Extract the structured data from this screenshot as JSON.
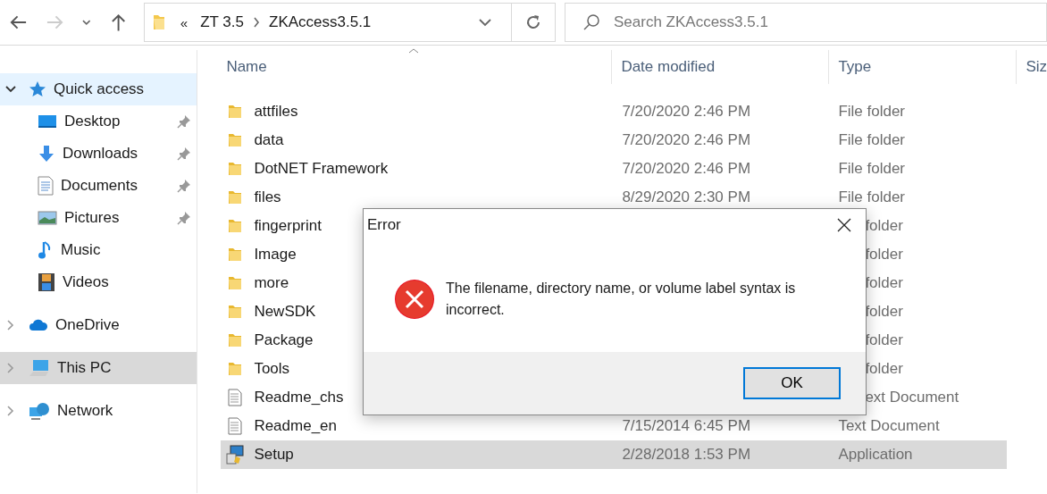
{
  "nav": {
    "overflow": "«",
    "path": [
      "ZT 3.5",
      "ZKAccess3.5.1"
    ],
    "search": {
      "placeholder": "Search ZKAccess3.5.1"
    }
  },
  "sidebar": {
    "items": [
      {
        "label": "Quick access",
        "kind": "star",
        "expanded": true,
        "selected": false,
        "highlighted": true,
        "children": [
          {
            "label": "Desktop",
            "kind": "desktop",
            "pinned": true
          },
          {
            "label": "Downloads",
            "kind": "download",
            "pinned": true
          },
          {
            "label": "Documents",
            "kind": "document",
            "pinned": true
          },
          {
            "label": "Pictures",
            "kind": "pictures",
            "pinned": true
          },
          {
            "label": "Music",
            "kind": "music",
            "pinned": false
          },
          {
            "label": "Videos",
            "kind": "videos",
            "pinned": false
          }
        ]
      },
      {
        "label": "OneDrive",
        "kind": "cloud",
        "expanded": false,
        "selected": false,
        "highlighted": false
      },
      {
        "label": "This PC",
        "kind": "pc",
        "expanded": false,
        "selected": true,
        "highlighted": false
      },
      {
        "label": "Network",
        "kind": "network",
        "expanded": false,
        "selected": false,
        "highlighted": false
      }
    ]
  },
  "table": {
    "columns": [
      "Name",
      "Date modified",
      "Type",
      "Siz"
    ],
    "rows": [
      {
        "name": "attfiles",
        "kind": "folder",
        "date": "7/20/2020 2:46 PM",
        "type": "File folder",
        "covered": false,
        "selected": false
      },
      {
        "name": "data",
        "kind": "folder",
        "date": "7/20/2020 2:46 PM",
        "type": "File folder",
        "covered": false,
        "selected": false
      },
      {
        "name": "DotNET Framework",
        "kind": "folder",
        "date": "7/20/2020 2:46 PM",
        "type": "File folder",
        "covered": false,
        "selected": false
      },
      {
        "name": "files",
        "kind": "folder",
        "date": "8/29/2020 2:30 PM",
        "type": "File folder",
        "covered": false,
        "selected": false
      },
      {
        "name": "fingerprint",
        "kind": "folder",
        "type": "folder",
        "covered": true,
        "selected": false
      },
      {
        "name": "Image",
        "kind": "folder",
        "type": "folder",
        "covered": true,
        "selected": false
      },
      {
        "name": "more",
        "kind": "folder",
        "type": "folder",
        "covered": true,
        "selected": false
      },
      {
        "name": "NewSDK",
        "kind": "folder",
        "type": "folder",
        "covered": true,
        "selected": false
      },
      {
        "name": "Package",
        "kind": "folder",
        "type": "folder",
        "covered": true,
        "selected": false
      },
      {
        "name": "Tools",
        "kind": "folder",
        "type": "folder",
        "covered": true,
        "selected": false
      },
      {
        "name": "Readme_chs",
        "kind": "text",
        "type": "ext Document",
        "covered": true,
        "selected": false
      },
      {
        "name": "Readme_en",
        "kind": "text",
        "date": "7/15/2014 6:45 PM",
        "type": "Text Document",
        "covered": false,
        "selected": false
      },
      {
        "name": "Setup",
        "kind": "app",
        "date": "2/28/2018 1:53 PM",
        "type": "Application",
        "covered": false,
        "selected": true
      }
    ]
  },
  "dialog": {
    "title": "Error",
    "message": "The filename, directory name, or volume label syntax is incorrect.",
    "buttons": [
      "OK"
    ]
  }
}
